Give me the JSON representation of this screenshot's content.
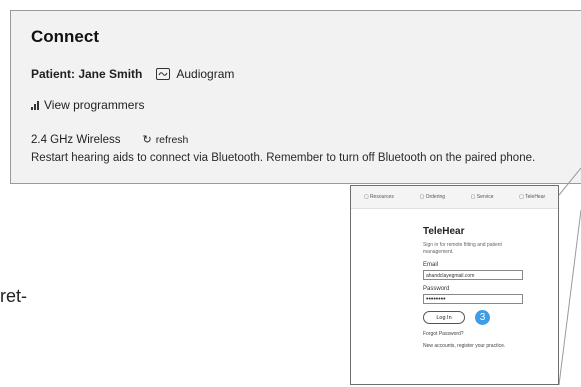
{
  "panel": {
    "title": "Connect",
    "patient_label": "Patient: Jane Smith",
    "audiogram_label": "Audiogram",
    "programmers_label": "View programmers",
    "wireless_label": "2.4 GHz Wireless",
    "refresh_label": "refresh",
    "restart_text": "Restart hearing aids to connect via Bluetooth. Remember to turn off Bluetooth on the paired phone."
  },
  "side_text": "ret-",
  "screenshot": {
    "tabs": [
      "Resources",
      "Ordering",
      "Service",
      "TeleHear"
    ],
    "title": "TeleHear",
    "subtitle": "Sign in for remote fitting and patient management.",
    "email_label": "Email",
    "email_value": "ahandclayegmail.com",
    "password_label": "Password",
    "password_value": "••••••••",
    "login_label": "Log In",
    "step_number": "3",
    "forgot_label": "Forgot Password?",
    "new_account_text": "New accounts, register your practice."
  },
  "colors": {
    "panel_bg": "#f2f2f2",
    "badge_blue": "#3b9ee6"
  }
}
